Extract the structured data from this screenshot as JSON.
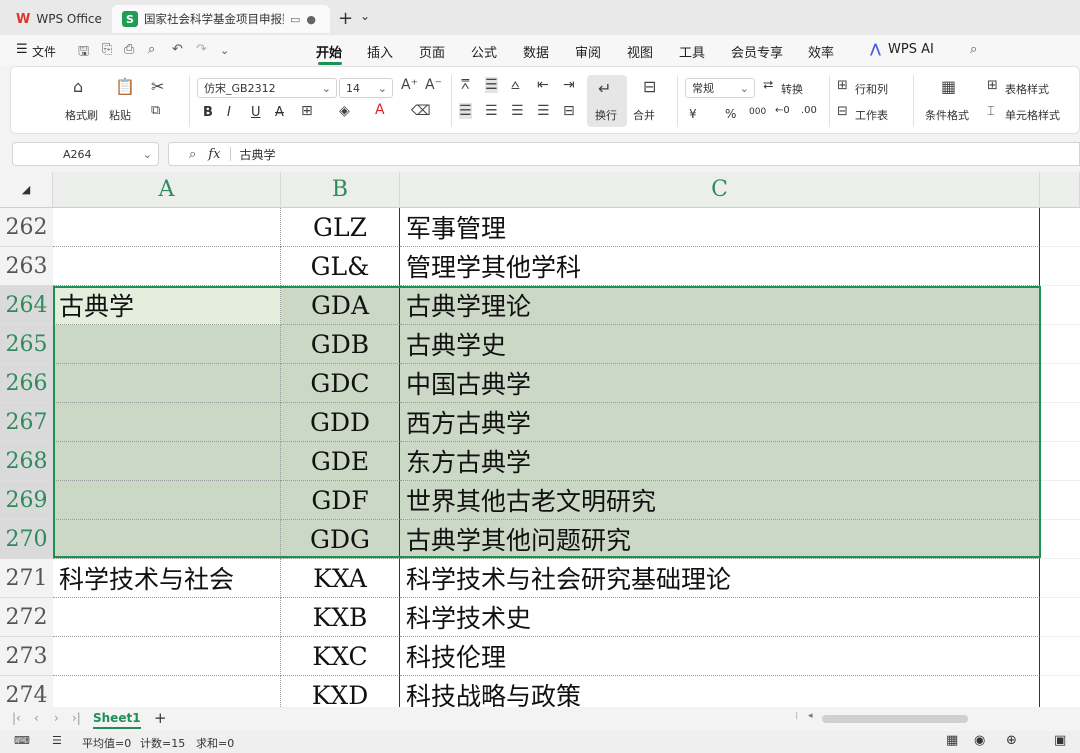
{
  "titlebar": {
    "home_tab": "WPS Office",
    "doc_tab": "国家社会科学基金项目申报数据代码表",
    "doc_badge": "S",
    "new_tab": "+",
    "tab_menu": "⌄"
  },
  "menubar": {
    "file": "文件",
    "items": [
      "开始",
      "插入",
      "页面",
      "公式",
      "数据",
      "审阅",
      "视图",
      "工具",
      "会员专享",
      "效率"
    ],
    "active": "开始",
    "ai": "WPS AI"
  },
  "ribbon": {
    "format_painter": "格式刷",
    "paste": "粘贴",
    "font_name": "仿宋_GB2312",
    "font_size": "14",
    "wrap": "换行",
    "merge": "合并",
    "number_format": "常规",
    "convert": "转换",
    "row_col": "行和列",
    "worksheet": "工作表",
    "conditional": "条件格式",
    "table_style": "表格样式",
    "cell_style": "单元格样式",
    "bold": "B",
    "italic": "I",
    "underline": "U",
    "strike": "A",
    "currency": "¥",
    "percent": "%",
    "thousands": "000"
  },
  "formulabar": {
    "cell_ref": "A264",
    "fx": "fx",
    "content": "古典学"
  },
  "columns": [
    "A",
    "B",
    "C"
  ],
  "rows": [
    {
      "num": "262",
      "a": "",
      "b": "GLZ",
      "c": "军事管理"
    },
    {
      "num": "263",
      "a": "",
      "b": "GL&",
      "c": "管理学其他学科"
    },
    {
      "num": "264",
      "a": "古典学",
      "b": "GDA",
      "c": "古典学理论"
    },
    {
      "num": "265",
      "a": "",
      "b": "GDB",
      "c": "古典学史"
    },
    {
      "num": "266",
      "a": "",
      "b": "GDC",
      "c": "中国古典学"
    },
    {
      "num": "267",
      "a": "",
      "b": "GDD",
      "c": "西方古典学"
    },
    {
      "num": "268",
      "a": "",
      "b": "GDE",
      "c": "东方古典学"
    },
    {
      "num": "269",
      "a": "",
      "b": "GDF",
      "c": "世界其他古老文明研究"
    },
    {
      "num": "270",
      "a": "",
      "b": "GDG",
      "c": "古典学其他问题研究"
    },
    {
      "num": "271",
      "a": "科学技术与社会",
      "b": "KXA",
      "c": "科学技术与社会研究基础理论"
    },
    {
      "num": "272",
      "a": "",
      "b": "KXB",
      "c": "科学技术史"
    },
    {
      "num": "273",
      "a": "",
      "b": "KXC",
      "c": "科技伦理"
    },
    {
      "num": "274",
      "a": "",
      "b": "KXD",
      "c": "科技战略与政策"
    }
  ],
  "sheetbar": {
    "sheet_name": "Sheet1",
    "add": "+"
  },
  "statusbar": {
    "average": "平均值=0",
    "count": "计数=15",
    "sum": "求和=0"
  },
  "colors": {
    "accent": "#1f8f58",
    "selection_fill": "#ccd8c6",
    "header_text": "#2f8a5e"
  }
}
